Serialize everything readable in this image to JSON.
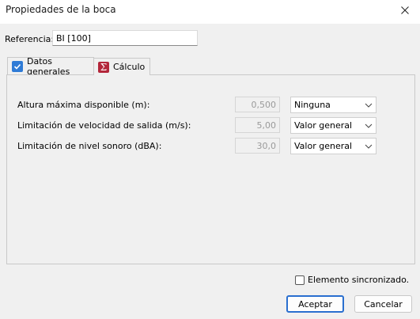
{
  "window": {
    "title": "Propiedades de la boca"
  },
  "referencia": {
    "label": "Referencia:",
    "value": "BI [100]"
  },
  "tabs": [
    {
      "label": "Datos generales",
      "icon": "checkbox-icon"
    },
    {
      "label": "Cálculo",
      "icon": "sigma-icon"
    }
  ],
  "rows": [
    {
      "label": "Altura máxima disponible (m):",
      "value": "0,500",
      "option": "Ninguna"
    },
    {
      "label": "Limitación de velocidad de salida (m/s):",
      "value": "5,00",
      "option": "Valor general"
    },
    {
      "label": "Limitación de nivel sonoro (dBA):",
      "value": "30,0",
      "option": "Valor general"
    }
  ],
  "sync": {
    "label": "Elemento sincronizado.",
    "checked": false
  },
  "buttons": {
    "ok": "Aceptar",
    "cancel": "Cancelar"
  },
  "colors": {
    "accent": "#2a6fcf",
    "sigma": "#b3263a"
  }
}
